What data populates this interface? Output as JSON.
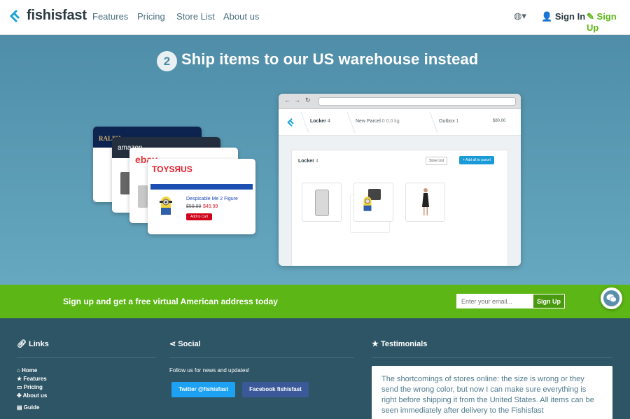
{
  "nav": {
    "brand": "fishisfast",
    "links": [
      "Features",
      "Pricing",
      "Store List",
      "About us"
    ],
    "signin": "Sign In",
    "signup": "Sign Up"
  },
  "hero": {
    "step": "2",
    "title": "Ship items to our US warehouse instead",
    "cards": {
      "ralph": "RALPH",
      "amazon": "amazon",
      "ebay": "ebay",
      "toysrus": "TOYSЯUS",
      "product_title": "Despicable Me 2 Figure",
      "price_old": "$59.99",
      "price_new": "$49.99",
      "add_cart": "Add to Cart"
    },
    "browser": {
      "tabs": [
        {
          "label": "Locker",
          "count": "4"
        },
        {
          "label": "New Parcel",
          "count": "0",
          "weight": "0.0 kg"
        },
        {
          "label": "Outbox",
          "count": "1"
        }
      ],
      "balance": "$80.00",
      "panel_title": "Locker",
      "panel_count": "4",
      "store_list": "Store List",
      "add_all": "+ Add all to parcel"
    }
  },
  "cta": {
    "text": "Sign up and get a free virtual American address today",
    "email_placeholder": "Enter your email...",
    "button": "Sign Up"
  },
  "footer": {
    "links_heading": "Links",
    "links": [
      "Home",
      "Features",
      "Pricing",
      "About us",
      "Guide"
    ],
    "social_heading": "Social",
    "social_text": "Follow us for news and updates!",
    "twitter": "Twitter @fishisfast",
    "facebook": "Facebook fishisfast",
    "testimonials_heading": "Testimonials",
    "testimonial": "The shortcomings of stores online: the size is wrong or they send the wrong color, but now I can make sure everything is right before shipping it from the United States. All items can be seen immediately after delivery to the Fishisfast"
  },
  "colors": {
    "accent_green": "#5cb615",
    "hero_blue": "#5d9eb7",
    "footer_bg": "#2e5565",
    "twitter": "#1da1f2",
    "facebook": "#3b5998"
  }
}
